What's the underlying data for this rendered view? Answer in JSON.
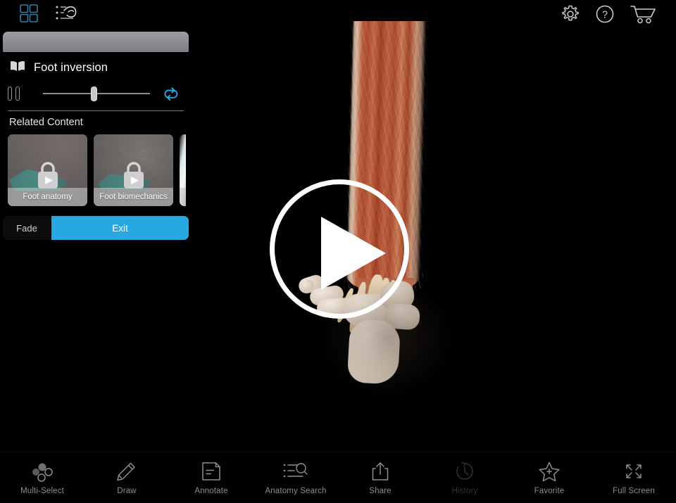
{
  "app": {
    "background_color": "#000000",
    "accent_color": "#28a8e0"
  },
  "topbar": {
    "left_icons": [
      {
        "name": "grid-view-icon",
        "label": "Grid view",
        "color": "#2f7fa8"
      },
      {
        "name": "muscle-list-icon",
        "label": "Muscle action list",
        "color": "#c8ccd0"
      }
    ],
    "right_icons": [
      {
        "name": "gear-icon",
        "label": "Settings"
      },
      {
        "name": "help-icon",
        "label": "Help"
      },
      {
        "name": "cart-icon",
        "label": "Cart"
      }
    ]
  },
  "panel": {
    "drag_handle_label": "Drag handle",
    "title": "Foot inversion",
    "book_icon": "open-book-icon",
    "player": {
      "pause_label": "Pause",
      "slider_value_percent": 48,
      "slider_min": 0,
      "slider_max": 100,
      "loop_label": "Loop",
      "loop_color": "#29a8e0"
    },
    "related_content_label": "Related Content",
    "thumbnails": [
      {
        "caption": "Foot anatomy",
        "locked": true,
        "has_play": true
      },
      {
        "caption": "Foot biomechanics",
        "locked": true,
        "has_play": true
      },
      {
        "caption": "",
        "locked": false,
        "has_play": false,
        "partial": true
      }
    ],
    "actions": {
      "fade_label": "Fade",
      "exit_label": "Exit",
      "exit_color": "#28a8e0"
    }
  },
  "viewer": {
    "play_button_label": "Play",
    "play_icon": "play-triangle-icon",
    "model_description": "Lower leg and foot — muscles, tendons and bones"
  },
  "bottombar": {
    "tools": [
      {
        "label": "Multi-Select",
        "icon": "multi-select-icon",
        "enabled": true
      },
      {
        "label": "Draw",
        "icon": "pencil-icon",
        "enabled": true
      },
      {
        "label": "Annotate",
        "icon": "annotate-page-icon",
        "enabled": true
      },
      {
        "label": "Anatomy Search",
        "icon": "anatomy-search-icon",
        "enabled": true
      },
      {
        "label": "Share",
        "icon": "share-icon",
        "enabled": true
      },
      {
        "label": "History",
        "icon": "history-clock-icon",
        "enabled": false
      },
      {
        "label": "Favorite",
        "icon": "star-plus-icon",
        "enabled": true
      },
      {
        "label": "Full Screen",
        "icon": "full-screen-icon",
        "enabled": true
      }
    ]
  }
}
